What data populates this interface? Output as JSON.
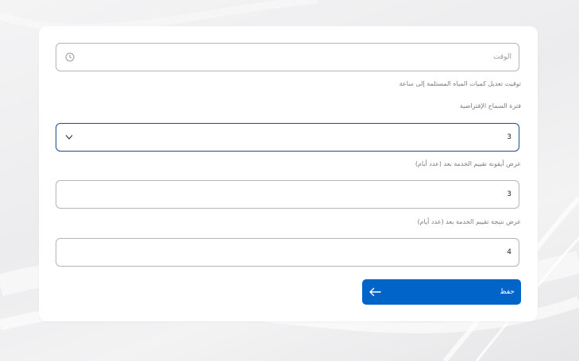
{
  "form": {
    "time_field": {
      "placeholder": "الوقت",
      "icon": "clock-icon"
    },
    "time_hint": "توقيت تعديل كميات المياه المستلمة إلى ساعة",
    "grace_period_label": "فترة السماح الإفتراضية",
    "grace_period_value": "3",
    "rating_icon_label": "عرض أيقونة تقييم الخدمة بعد (عدد أيام)",
    "rating_icon_value": "3",
    "rating_result_label": "عرض نتيجة تقييم الخدمة بعد (عدد أيام)",
    "rating_result_value": "4",
    "save_label": "حفظ"
  },
  "colors": {
    "primary": "#0064c8",
    "active_border": "#1f4f8a",
    "card": "#ffffff"
  }
}
